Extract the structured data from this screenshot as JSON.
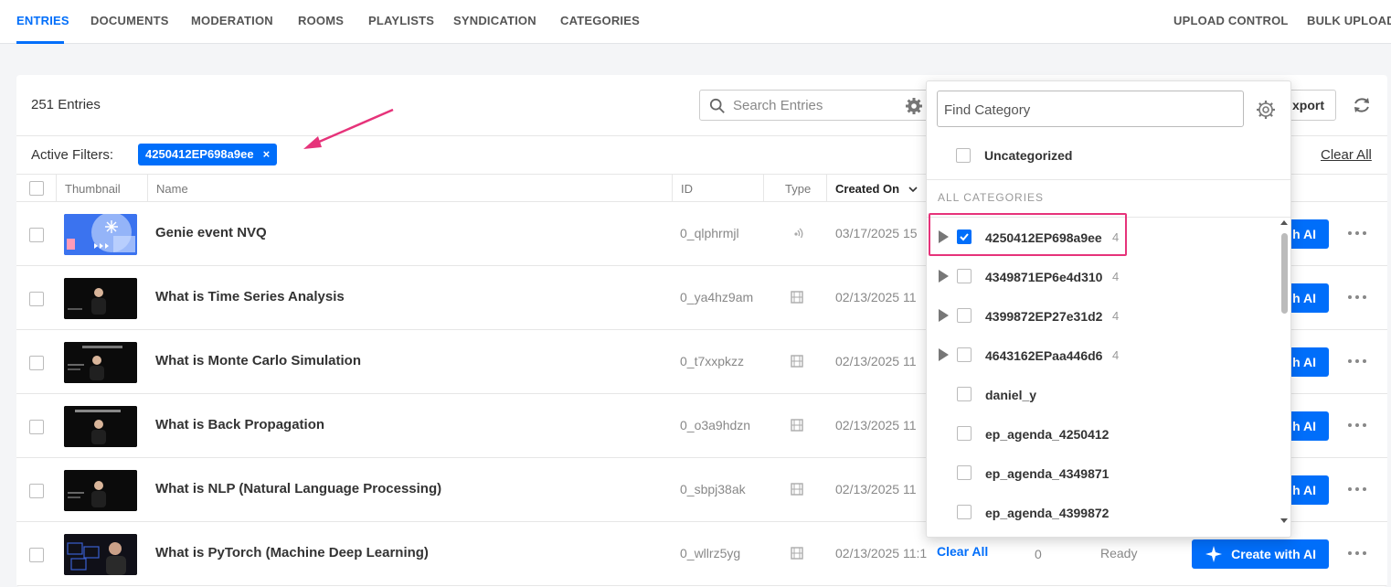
{
  "nav": {
    "tabs": [
      {
        "label": "ENTRIES",
        "active": true
      },
      {
        "label": "DOCUMENTS"
      },
      {
        "label": "MODERATION"
      },
      {
        "label": "ROOMS"
      },
      {
        "label": "PLAYLISTS"
      },
      {
        "label": "SYNDICATION"
      },
      {
        "label": "CATEGORIES"
      }
    ],
    "right": [
      {
        "label": "UPLOAD CONTROL"
      },
      {
        "label": "BULK UPLOAD"
      }
    ]
  },
  "toolbar": {
    "entries_count": "251 Entries",
    "search_placeholder": "Search Entries",
    "export_label": "xport"
  },
  "filters": {
    "label": "Active Filters:",
    "tags": [
      "4250412EP698a9ee"
    ],
    "tag_close": "×",
    "clear_all": "Clear All"
  },
  "table": {
    "headers": {
      "thumbnail": "Thumbnail",
      "name": "Name",
      "id": "ID",
      "type": "Type",
      "created_on": "Created On"
    },
    "rows": [
      {
        "name": "Genie event NVQ",
        "id": "0_qlphrmjl",
        "type": "live",
        "date": "03/17/2025 15",
        "ai": "h AI",
        "thumb": "genie"
      },
      {
        "name": "What is Time Series Analysis",
        "id": "0_ya4hz9am",
        "type": "video",
        "date": "02/13/2025 11",
        "ai": "h AI",
        "thumb": "dark"
      },
      {
        "name": "What is Monte Carlo Simulation",
        "id": "0_t7xxpkzz",
        "type": "video",
        "date": "02/13/2025 11",
        "ai": "h AI",
        "thumb": "dark"
      },
      {
        "name": "What is Back Propagation",
        "id": "0_o3a9hdzn",
        "type": "video",
        "date": "02/13/2025 11",
        "ai": "h AI",
        "thumb": "dark"
      },
      {
        "name": "What is NLP (Natural Language Processing)",
        "id": "0_sbpj38ak",
        "type": "video",
        "date": "02/13/2025 11",
        "ai": "h AI",
        "thumb": "dark"
      },
      {
        "name": "What is PyTorch (Machine Deep Learning)",
        "id": "0_wllrz5yg",
        "type": "video",
        "date": "02/13/2025 11:1",
        "ai": "Create with AI",
        "thumb": "dark",
        "plays": "0",
        "status": "Ready"
      }
    ]
  },
  "category_dropdown": {
    "find_placeholder": "Find Category",
    "uncategorized": "Uncategorized",
    "all_categories": "ALL CATEGORIES",
    "items": [
      {
        "label": "4250412EP698a9ee",
        "count": "4",
        "checked": true,
        "expandable": true
      },
      {
        "label": "4349871EP6e4d310",
        "count": "4",
        "checked": false,
        "expandable": true
      },
      {
        "label": "4399872EP27e31d2",
        "count": "4",
        "checked": false,
        "expandable": true
      },
      {
        "label": "4643162EPaa446d6",
        "count": "4",
        "checked": false,
        "expandable": true
      },
      {
        "label": "daniel_y",
        "count": "",
        "checked": false,
        "expandable": false
      },
      {
        "label": "ep_agenda_4250412",
        "count": "",
        "checked": false,
        "expandable": false
      },
      {
        "label": "ep_agenda_4349871",
        "count": "",
        "checked": false,
        "expandable": false
      },
      {
        "label": "ep_agenda_4399872",
        "count": "",
        "checked": false,
        "expandable": false
      }
    ],
    "footer_clear": "Clear All"
  },
  "colors": {
    "accent": "#006efa",
    "highlight": "#e6337a"
  }
}
